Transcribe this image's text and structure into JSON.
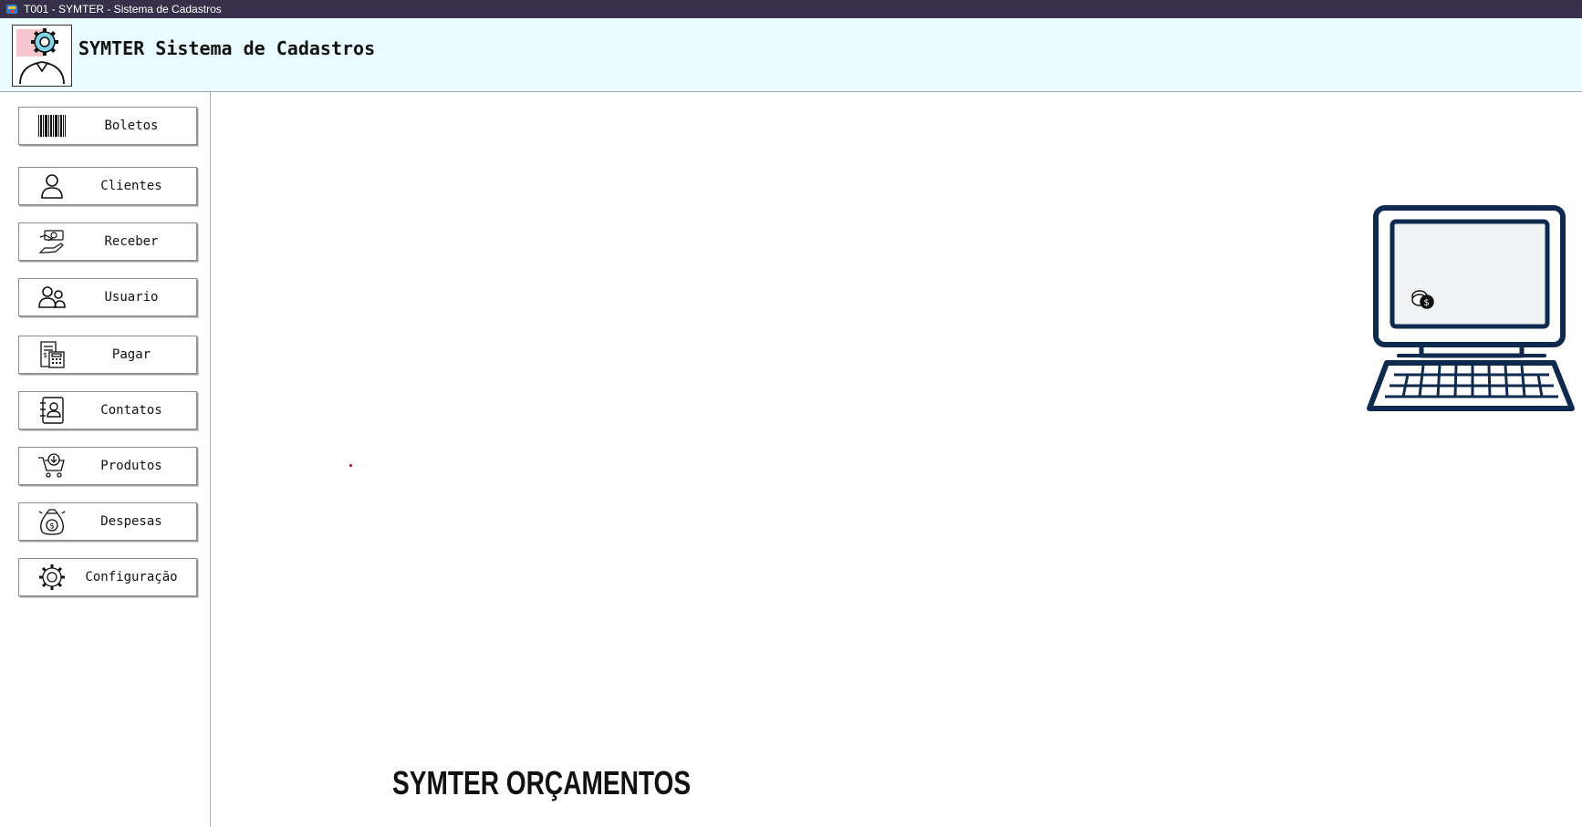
{
  "window": {
    "title": "T001 - SYMTER - Sistema de Cadastros"
  },
  "header": {
    "app_title": "SYMTER Sistema de Cadastros",
    "logo_icon": "gear-user-icon"
  },
  "sidebar": {
    "items": [
      {
        "label": "Boletos",
        "icon": "barcode-icon"
      },
      {
        "label": "Clientes",
        "icon": "person-icon"
      },
      {
        "label": "Receber",
        "icon": "hand-money-icon"
      },
      {
        "label": "Usuario",
        "icon": "users-icon"
      },
      {
        "label": "Pagar",
        "icon": "calculator-invoice-icon"
      },
      {
        "label": "Contatos",
        "icon": "contact-book-icon"
      },
      {
        "label": "Produtos",
        "icon": "cart-icon"
      },
      {
        "label": "Despesas",
        "icon": "money-bag-icon"
      },
      {
        "label": "Configuração",
        "icon": "gear-icon"
      }
    ]
  },
  "main": {
    "illustration_icon": "computer-coins-icon",
    "brand_text": "SYMTER ORÇAMENTOS"
  },
  "colors": {
    "titlebar": "#36304a",
    "header_bg": "#eafcff",
    "computer_stroke": "#0f2a4f",
    "logo_accent": "#f6c6cf"
  }
}
